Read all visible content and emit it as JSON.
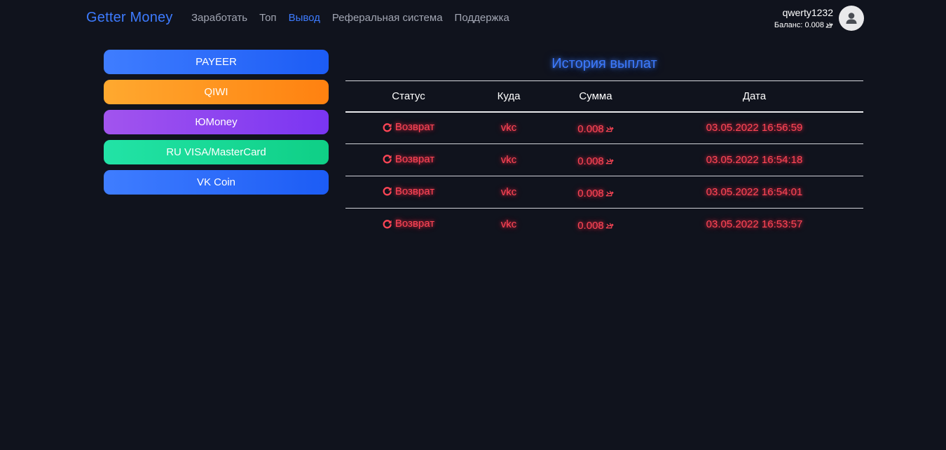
{
  "navbar": {
    "brand": "Getter Money",
    "links": [
      {
        "label": "Заработать",
        "active": false
      },
      {
        "label": "Топ",
        "active": false
      },
      {
        "label": "Вывод",
        "active": true
      },
      {
        "label": "Реферальная система",
        "active": false
      },
      {
        "label": "Поддержка",
        "active": false
      }
    ],
    "user": {
      "username": "qwerty1232",
      "balance_label": "Баланс: 0.008"
    },
    "brand_color": "#3d7bff"
  },
  "methods": [
    {
      "label": "PAYEER",
      "color": "#2c6cfb"
    },
    {
      "label": "QIWI",
      "color": "#ff9520"
    },
    {
      "label": "ЮMoney",
      "color": "#8c44f0"
    },
    {
      "label": "RU VISA/MasterCard",
      "color": "#18d996"
    },
    {
      "label": "VK Coin",
      "color": "#2c6cfb"
    }
  ],
  "history": {
    "title": "История выплат",
    "columns": [
      "Статус",
      "Куда",
      "Сумма",
      "Дата"
    ],
    "rows": [
      {
        "status": "Возврат",
        "where": "vkc",
        "sum": "0.008",
        "date": "03.05.2022 16:56:59"
      },
      {
        "status": "Возврат",
        "where": "vkc",
        "sum": "0.008",
        "date": "03.05.2022 16:54:18"
      },
      {
        "status": "Возврат",
        "where": "vkc",
        "sum": "0.008",
        "date": "03.05.2022 16:54:01"
      },
      {
        "status": "Возврат",
        "where": "vkc",
        "sum": "0.008",
        "date": "03.05.2022 16:53:57"
      }
    ],
    "status_color": "#ff4656",
    "status_icon": "redo-icon"
  }
}
